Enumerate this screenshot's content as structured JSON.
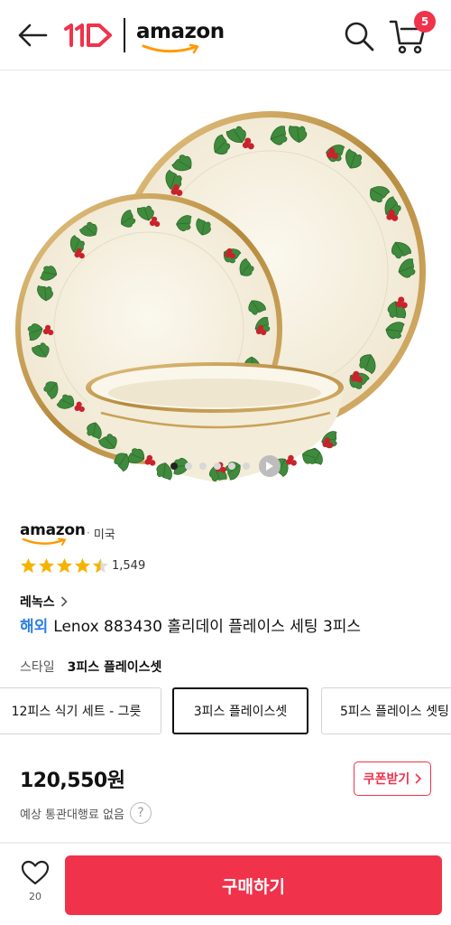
{
  "header": {
    "back_icon": "arrow-left-icon",
    "store_logo_text": "11",
    "partner_logo_text": "amazon",
    "search_icon": "search-icon",
    "cart_icon": "cart-icon",
    "cart_count": "5"
  },
  "gallery": {
    "image_count": 7,
    "active_index": 0,
    "has_video": true
  },
  "seller": {
    "logo_text": "amazon",
    "country": "미국"
  },
  "rating": {
    "stars": 4.5,
    "review_count": "1,549"
  },
  "product": {
    "brand": "레녹스",
    "overseas_tag": "해외",
    "title": "Lenox 883430 홀리데이 플레이스 세팅 3피스",
    "style_label": "스타일",
    "style_value": "3피스 플레이스셋",
    "options": [
      {
        "label": "12피스 식기 세트 - 그릇",
        "selected": false
      },
      {
        "label": "3피스 플레이스셋",
        "selected": true
      },
      {
        "label": "5피스 플레이스 셋팅",
        "selected": false
      }
    ],
    "price": "120,550원",
    "coupon_label": "쿠폰받기",
    "customs_text": "예상 통관대행료 없음"
  },
  "bottom_bar": {
    "wish_count": "20",
    "buy_label": "구매하기"
  },
  "colors": {
    "brand_red": "#f0324b",
    "overseas_blue": "#2e7ee0",
    "star_gold": "#f5b301",
    "holly_green": "#3f8a3c",
    "berry_red": "#c8232c",
    "gold_rim": "#c9a25a",
    "cream": "#f6f1e2"
  }
}
